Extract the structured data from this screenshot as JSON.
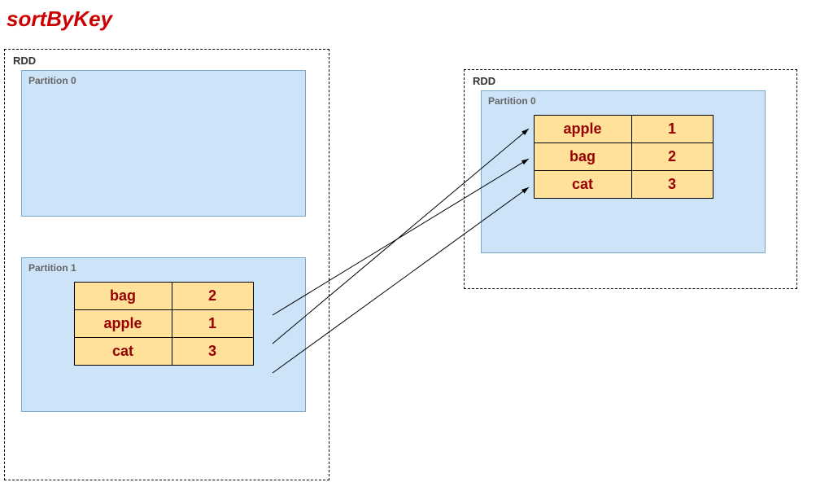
{
  "title": "sortByKey",
  "left_rdd": {
    "label": "RDD",
    "partitions": [
      {
        "label": "Partition 0",
        "rows": []
      },
      {
        "label": "Partition 1",
        "rows": [
          {
            "key": "bag",
            "value": "2"
          },
          {
            "key": "apple",
            "value": "1"
          },
          {
            "key": "cat",
            "value": "3"
          }
        ]
      }
    ]
  },
  "right_rdd": {
    "label": "RDD",
    "partitions": [
      {
        "label": "Partition 0",
        "rows": [
          {
            "key": "apple",
            "value": "1"
          },
          {
            "key": "bag",
            "value": "2"
          },
          {
            "key": "cat",
            "value": "3"
          }
        ]
      }
    ]
  },
  "arrows": [
    {
      "from_row": 0,
      "to_row": 1
    },
    {
      "from_row": 1,
      "to_row": 0
    },
    {
      "from_row": 2,
      "to_row": 2
    }
  ]
}
